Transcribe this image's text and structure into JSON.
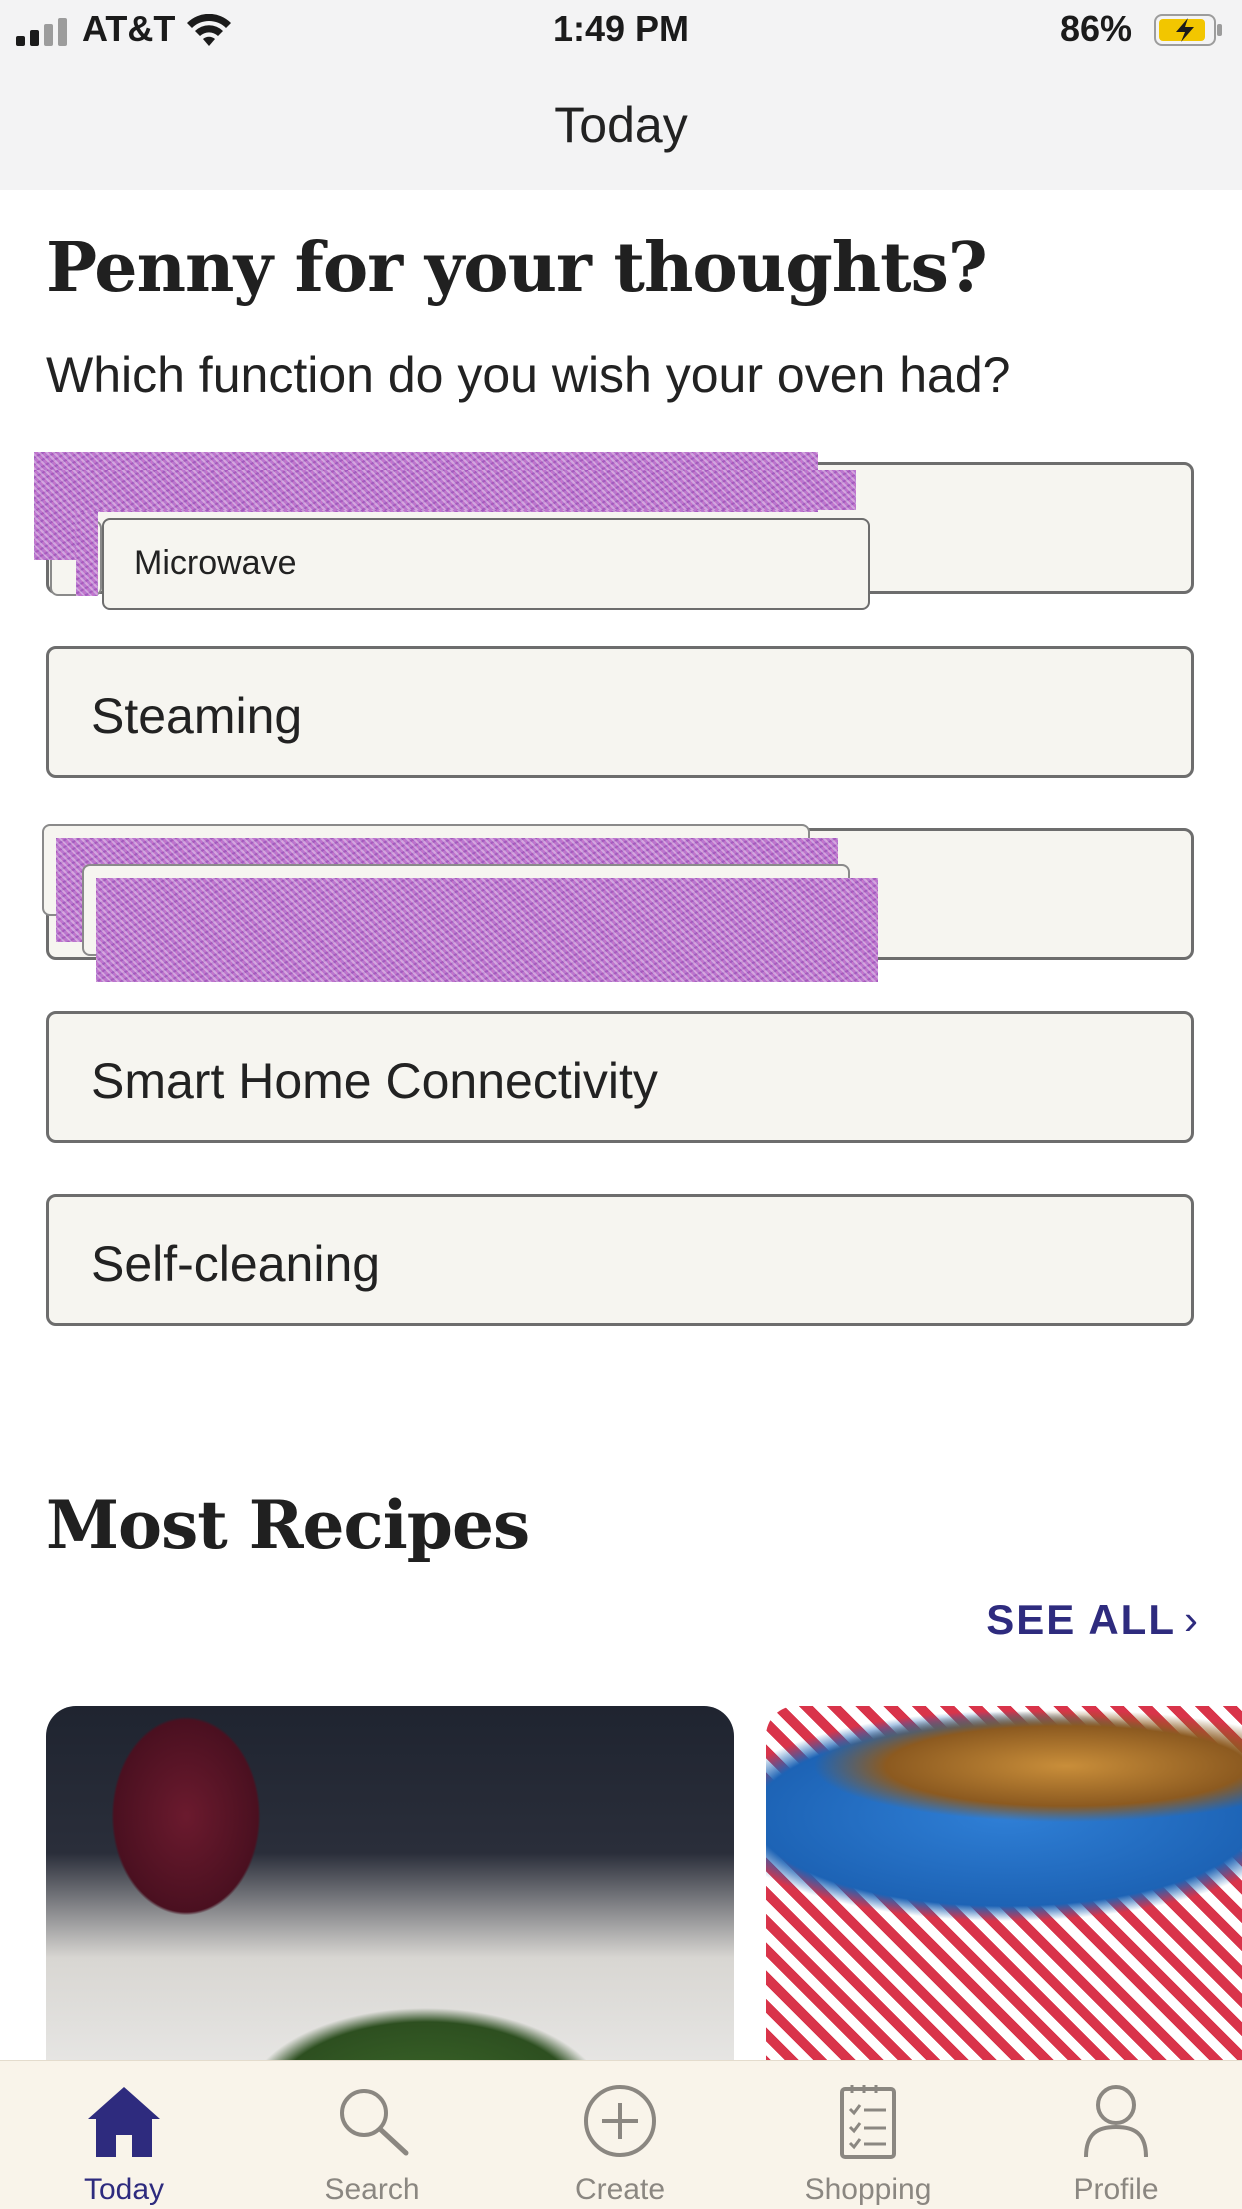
{
  "status_bar": {
    "carrier": "AT&T",
    "time": "1:49 PM",
    "battery": "86%"
  },
  "nav": {
    "title": "Today"
  },
  "poll": {
    "title": "Penny for your thoughts?",
    "question": "Which function do you wish your oven had?",
    "options": [
      {
        "label": ""
      },
      {
        "label": "Steaming"
      },
      {
        "label": ""
      },
      {
        "label": "Smart Home Connectivity"
      },
      {
        "label": "Self-cleaning"
      }
    ],
    "popup_label": "Microwave"
  },
  "recipes": {
    "title": "Most Recipes",
    "see_all": "SEE ALL",
    "see_all_chevron": "›"
  },
  "tabs": [
    {
      "label": "Today",
      "icon": "home-icon",
      "active": true
    },
    {
      "label": "Search",
      "icon": "search-icon",
      "active": false
    },
    {
      "label": "Create",
      "icon": "plus-circle-icon",
      "active": false
    },
    {
      "label": "Shopping",
      "icon": "checklist-icon",
      "active": false
    },
    {
      "label": "Profile",
      "icon": "person-icon",
      "active": false
    }
  ],
  "colors": {
    "accent": "#2e2b7e",
    "option_bg": "#f6f5f0",
    "battery": "#f2c600"
  }
}
